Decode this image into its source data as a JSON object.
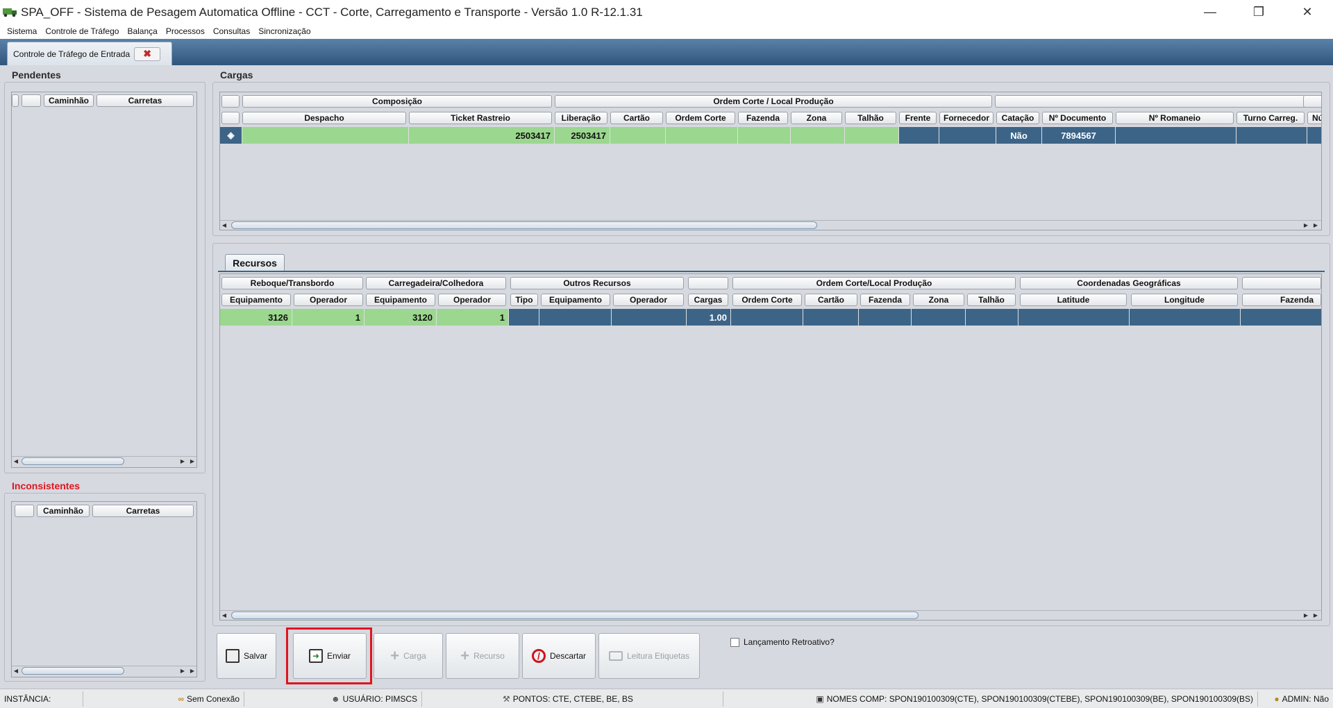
{
  "window": {
    "title": "SPA_OFF - Sistema de Pesagem Automatica Offline - CCT - Corte, Carregamento e Transporte - Versão 1.0 R-12.1.31",
    "icon": "truck-icon"
  },
  "menu": [
    "Sistema",
    "Controle de Tráfego",
    "Balança",
    "Processos",
    "Consultas",
    "Sincronização"
  ],
  "tab": {
    "label": "Controle de Tráfego de Entrada",
    "close_icon": "close-x-icon"
  },
  "pendentes": {
    "title": "Pendentes",
    "headers": [
      "",
      "",
      "Caminhão",
      "Carretas"
    ]
  },
  "inconsistentes": {
    "title": "Inconsistentes",
    "headers": [
      "",
      "Caminhão",
      "Carretas"
    ],
    "title_color": "#e0141e"
  },
  "cargas": {
    "title": "Cargas",
    "group_headers": [
      "",
      "Composição",
      "Ordem Corte / Local Produção",
      "",
      ""
    ],
    "headers": [
      "",
      "Despacho",
      "Ticket Rastreio",
      "Liberação",
      "Cartão",
      "Ordem Corte",
      "Fazenda",
      "Zona",
      "Talhão",
      "Frente",
      "Fornecedor",
      "Catação",
      "Nº Documento",
      "Nº Romaneio",
      "Turno Carreg.",
      "Nú"
    ],
    "row": [
      "",
      "",
      "2503417",
      "2503417",
      "",
      "",
      "",
      "",
      "",
      "",
      "",
      "Não",
      "7894567",
      "",
      "",
      ""
    ]
  },
  "recursos": {
    "tab_label": "Recursos",
    "group_headers": [
      "Reboque/Transbordo",
      "Carregadeira/Colhedora",
      "Outros Recursos",
      "",
      "Ordem Corte/Local Produção",
      "Coordenadas Geográficas",
      ""
    ],
    "headers": [
      "Equipamento",
      "Operador",
      "Equipamento",
      "Operador",
      "Tipo",
      "Equipamento",
      "Operador",
      "Cargas",
      "Ordem Corte",
      "Cartão",
      "Fazenda",
      "Zona",
      "Talhão",
      "Latitude",
      "Longitude",
      "Fazenda"
    ],
    "row": [
      "3126",
      "1",
      "3120",
      "1",
      "",
      "",
      "",
      "1.00",
      "",
      "",
      "",
      "",
      "",
      "",
      "",
      ""
    ]
  },
  "buttons": {
    "salvar": "Salvar",
    "enviar": "Enviar",
    "carga": "Carga",
    "recurso": "Recurso",
    "descartar": "Descartar",
    "leitura": "Leitura Etiquetas"
  },
  "retroativo_label": "Lançamento Retroativo?",
  "retroativo_checked": false,
  "status": {
    "instancia": "INSTÂNCIA:",
    "conexao": "Sem Conexão",
    "usuario": "USUÁRIO: PIMSCS",
    "pontos": "PONTOS: CTE, CTEBE, BE, BS",
    "nomes_comp": "NOMES COMP: SPON190100309(CTE), SPON190100309(CTEBE), SPON190100309(BE), SPON190100309(BS)",
    "admin": "ADMIN: Não"
  },
  "colors": {
    "row_green": "#9bd78f",
    "row_blue": "#3c6487",
    "highlight_red": "#e0141e",
    "tab_blue": "#2f557d"
  }
}
